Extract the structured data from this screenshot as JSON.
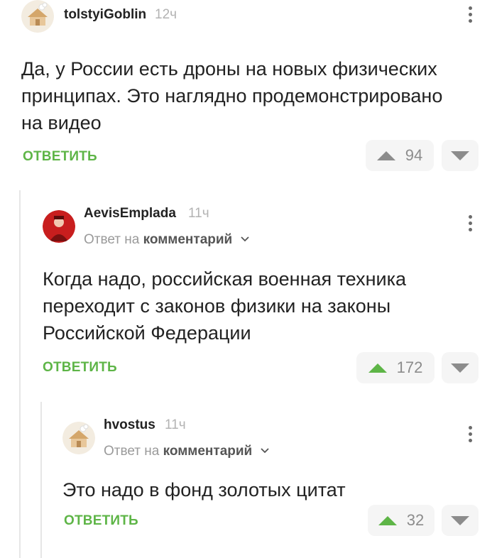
{
  "colors": {
    "accent_green": "#5eb547",
    "neutral_arrow": "#8c8c8c",
    "vote_bg": "#f5f5f5"
  },
  "comments": [
    {
      "username": "tolstyiGoblin",
      "time": "12ч",
      "avatar_icon": "house-avatar-icon",
      "text_lines": [
        "Да, у России есть дроны на новых физических",
        "принципах. Это наглядно продемонстрировано",
        "на видео"
      ],
      "reply_label": "ОТВЕТИТЬ",
      "votes": "94",
      "upvote_active": false
    },
    {
      "username": "AevisEmplada",
      "time": "11ч",
      "avatar_icon": "red-portrait-avatar-icon",
      "reply_to_prefix": "Ответ на",
      "reply_to_link": "комментарий",
      "text_lines": [
        "Когда надо, российская военная техника",
        "переходит с законов физики на законы",
        "Российской Федерации"
      ],
      "reply_label": "ОТВЕТИТЬ",
      "votes": "172",
      "upvote_active": true
    },
    {
      "username": "hvostus",
      "time": "11ч",
      "avatar_icon": "house-avatar-icon",
      "reply_to_prefix": "Ответ на",
      "reply_to_link": "комментарий",
      "text_lines": [
        "Это надо в фонд золотых цитат"
      ],
      "reply_label": "ОТВЕТИТЬ",
      "votes": "32",
      "upvote_active": true
    }
  ]
}
